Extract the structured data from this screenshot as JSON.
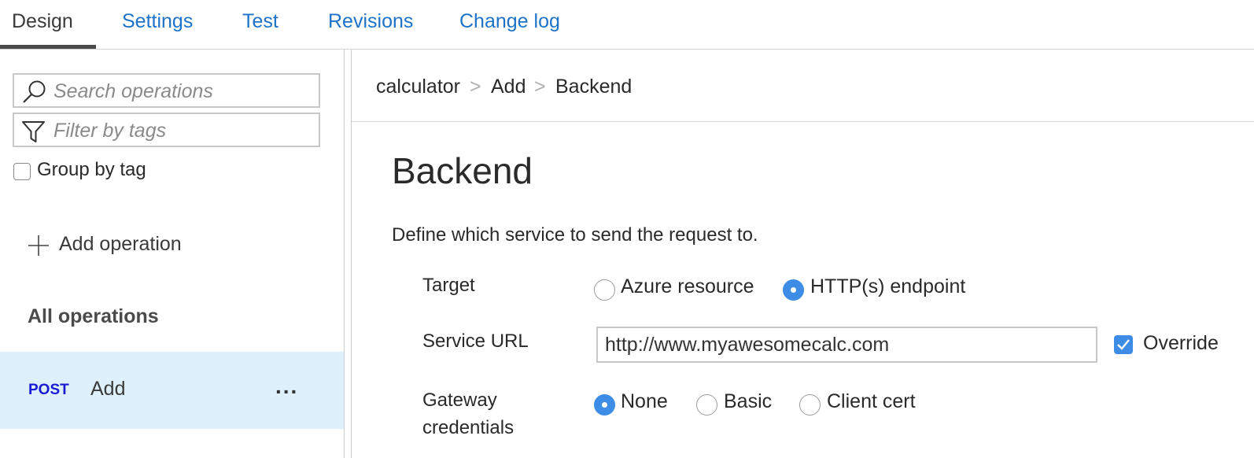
{
  "tabs": [
    {
      "label": "Design"
    },
    {
      "label": "Settings"
    },
    {
      "label": "Test"
    },
    {
      "label": "Revisions"
    },
    {
      "label": "Change log"
    }
  ],
  "sidebar": {
    "search_placeholder": "Search operations",
    "filter_placeholder": "Filter by tags",
    "group_by_tag_label": "Group by tag",
    "group_by_tag_checked": false,
    "add_operation_label": "Add operation",
    "section_title": "All operations",
    "operations": [
      {
        "method": "POST",
        "name": "Add",
        "more": "...",
        "selected": true
      }
    ]
  },
  "breadcrumb": [
    "calculator",
    "Add",
    "Backend"
  ],
  "breadcrumb_separator": ">",
  "main": {
    "title": "Backend",
    "description": "Define which service to send the request to.",
    "target": {
      "label": "Target",
      "options": [
        "Azure resource",
        "HTTP(s) endpoint"
      ],
      "selected": "HTTP(s) endpoint"
    },
    "service_url": {
      "label": "Service URL",
      "value": "http://www.myawesomecalc.com",
      "override_label": "Override",
      "override_checked": true
    },
    "gateway_credentials": {
      "label_line1": "Gateway",
      "label_line2": "credentials",
      "options": [
        "None",
        "Basic",
        "Client cert"
      ],
      "selected": "None"
    }
  },
  "colors": {
    "link": "#1e73c8",
    "accent": "#3d8ce6",
    "selected_row": "#def0fb",
    "method_post": "#1a1ad6"
  }
}
